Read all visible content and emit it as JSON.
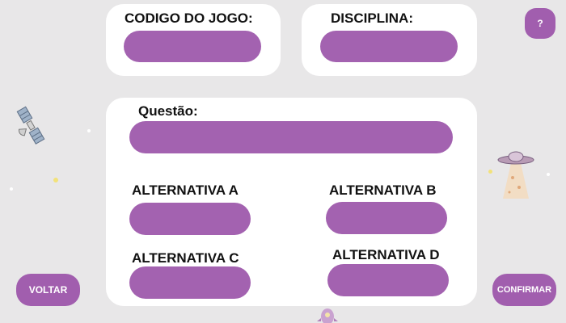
{
  "form": {
    "game_code_label": "CODIGO DO JOGO:",
    "subject_label": "DISCIPLINA:",
    "question_label": "Questão:",
    "alt_a_label": "ALTERNATIVA A",
    "alt_b_label": "ALTERNATIVA B",
    "alt_c_label": "ALTERNATIVA C",
    "alt_d_label": "ALTERNATIVA D"
  },
  "buttons": {
    "help": "?",
    "back": "VOLTAR",
    "confirm": "CONFIRMAR"
  },
  "colors": {
    "background": "#e8e7e8",
    "panel": "#ffffff",
    "accent": "#a362b0"
  },
  "icons": {
    "satellite": "satellite-icon",
    "ufo": "ufo-icon",
    "rocket": "rocket-icon"
  }
}
